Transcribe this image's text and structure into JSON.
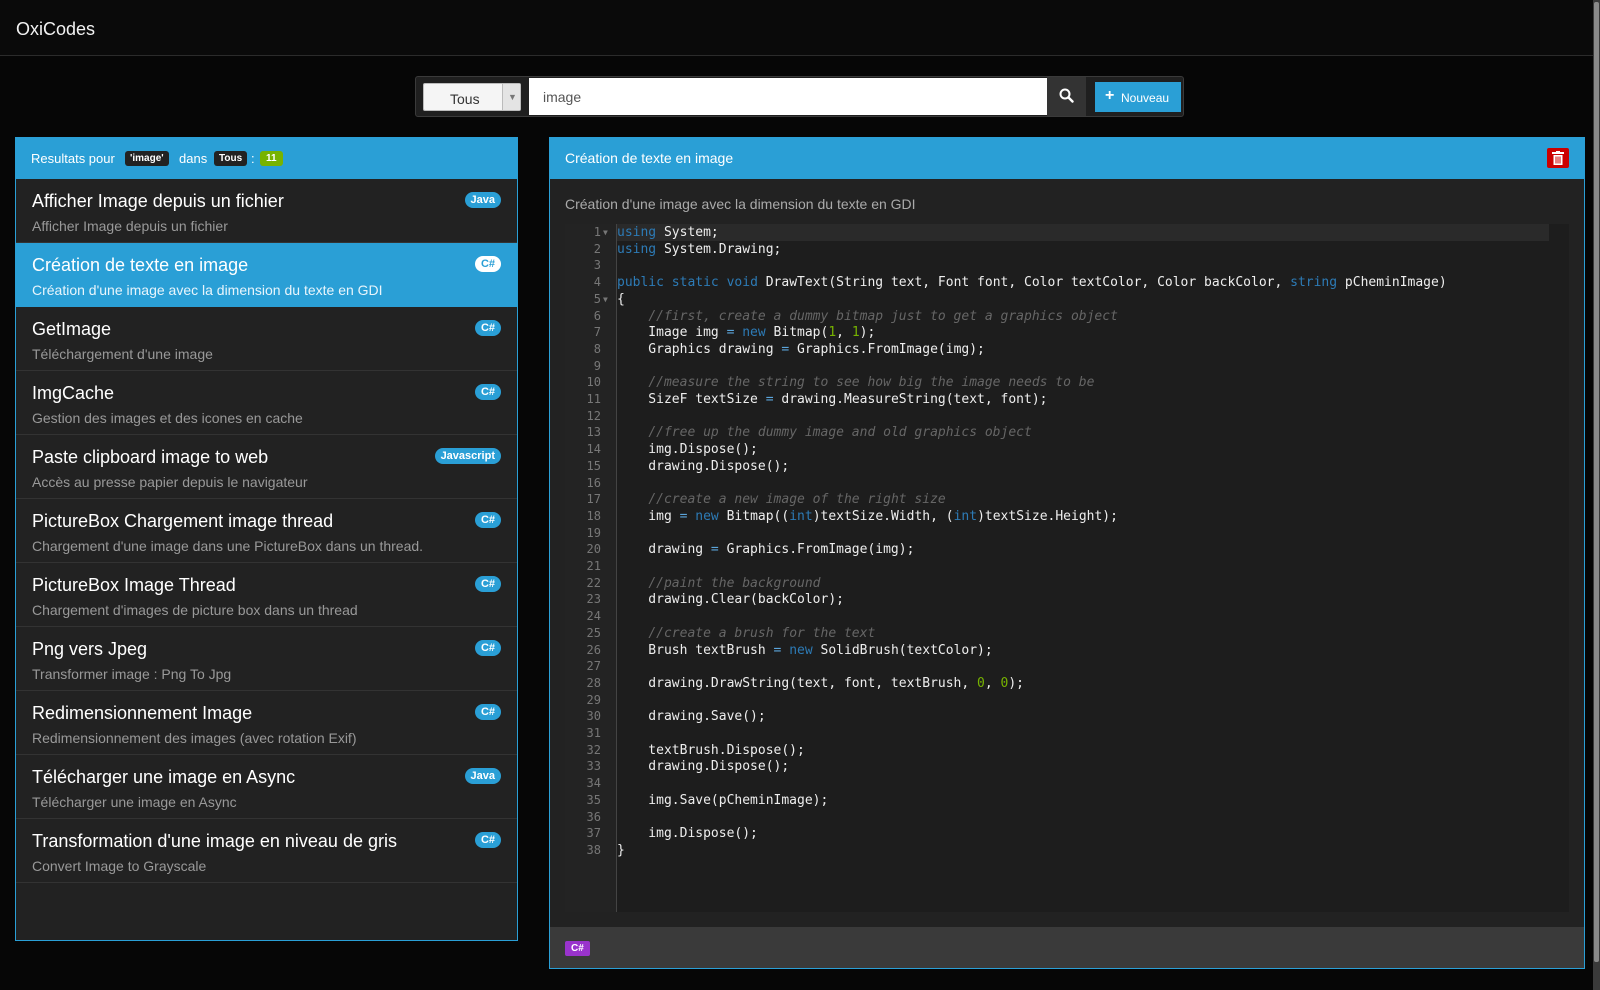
{
  "app": {
    "brand": "OxiCodes"
  },
  "search": {
    "filter_value": "Tous",
    "query": "image",
    "new_label": "Nouveau"
  },
  "results": {
    "prefix": "Resultats pour",
    "query_chip": "'image'",
    "in_word": "dans",
    "scope_chip": "Tous",
    "colon": ":",
    "count": "11",
    "items": [
      {
        "title": "Afficher Image depuis un fichier",
        "desc": "Afficher Image depuis un fichier",
        "lang": "Java"
      },
      {
        "title": "Création de texte en image",
        "desc": "Création d'une image avec la dimension du texte en GDI",
        "lang": "C#"
      },
      {
        "title": "GetImage",
        "desc": "Téléchargement d'une image",
        "lang": "C#"
      },
      {
        "title": "ImgCache",
        "desc": "Gestion des images et des icones en cache",
        "lang": "C#"
      },
      {
        "title": "Paste clipboard image to web",
        "desc": "Accès au presse papier depuis le navigateur",
        "lang": "Javascript"
      },
      {
        "title": "PictureBox Chargement image thread",
        "desc": "Chargement d'une image dans une PictureBox dans un thread.",
        "lang": "C#"
      },
      {
        "title": "PictureBox Image Thread",
        "desc": "Chargement d'images de picture box dans un thread",
        "lang": "C#"
      },
      {
        "title": "Png vers Jpeg",
        "desc": "Transformer image : Png To Jpg",
        "lang": "C#"
      },
      {
        "title": "Redimensionnement Image",
        "desc": "Redimensionnement des images (avec rotation Exif)",
        "lang": "C#"
      },
      {
        "title": "Télécharger une image en Async",
        "desc": "Télécharger une image en Async",
        "lang": "Java"
      },
      {
        "title": "Transformation d'une image en niveau de gris",
        "desc": "Convert Image to Grayscale",
        "lang": "C#"
      }
    ],
    "active_index": 1
  },
  "detail": {
    "title": "Création de texte en image",
    "description": "Création d'une image avec la dimension du texte en GDI",
    "language": "C#",
    "code_lines": [
      "using System;",
      "using System.Drawing;",
      "",
      "public static void DrawText(String text, Font font, Color textColor, Color backColor, string pCheminImage)",
      "{",
      "    //first, create a dummy bitmap just to get a graphics object",
      "    Image img = new Bitmap(1, 1);",
      "    Graphics drawing = Graphics.FromImage(img);",
      "",
      "    //measure the string to see how big the image needs to be",
      "    SizeF textSize = drawing.MeasureString(text, font);",
      "",
      "    //free up the dummy image and old graphics object",
      "    img.Dispose();",
      "    drawing.Dispose();",
      "",
      "    //create a new image of the right size",
      "    img = new Bitmap((int)textSize.Width, (int)textSize.Height);",
      "",
      "    drawing = Graphics.FromImage(img);",
      "",
      "    //paint the background",
      "    drawing.Clear(backColor);",
      "",
      "    //create a brush for the text",
      "    Brush textBrush = new SolidBrush(textColor);",
      "",
      "    drawing.DrawString(text, font, textBrush, 0, 0);",
      "",
      "    drawing.Save();",
      "",
      "    textBrush.Dispose();",
      "    drawing.Dispose();",
      "",
      "    img.Save(pCheminImage);",
      "",
      "    img.Dispose();",
      "}"
    ],
    "fold_lines": [
      1,
      5
    ]
  },
  "colors": {
    "accent": "#2a9fd6",
    "success": "#77b300",
    "danger": "#cc0000",
    "purple": "#9933cc"
  },
  "icons": {
    "search": "search-icon",
    "new": "plus-icon",
    "delete": "trash-icon"
  }
}
